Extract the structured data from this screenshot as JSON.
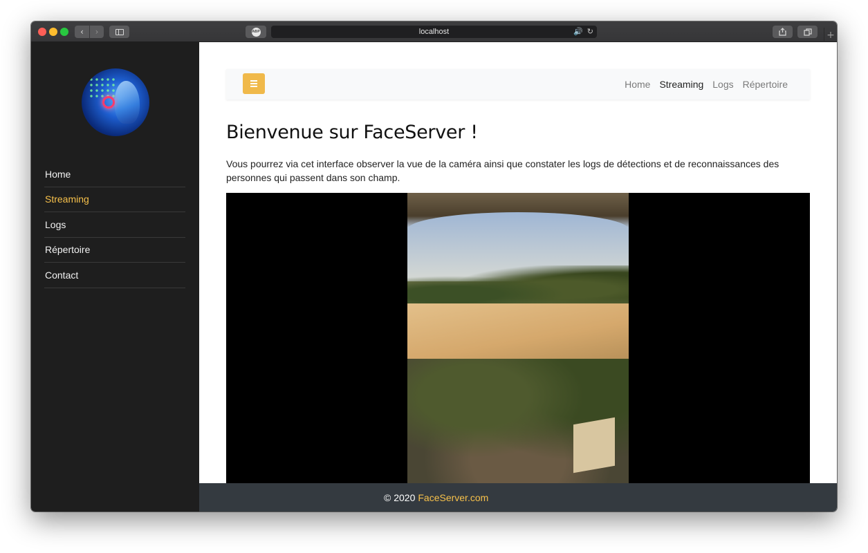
{
  "browser": {
    "url": "localhost",
    "abp_label": "ABP",
    "back_icon": "‹",
    "forward_icon": "›",
    "new_tab_icon": "+"
  },
  "sidebar": {
    "items": [
      {
        "label": "Home",
        "active": false
      },
      {
        "label": "Streaming",
        "active": true
      },
      {
        "label": "Logs",
        "active": false
      },
      {
        "label": "Répertoire",
        "active": false
      },
      {
        "label": "Contact",
        "active": false
      }
    ]
  },
  "topnav": {
    "items": [
      {
        "label": "Home",
        "active": false
      },
      {
        "label": "Streaming",
        "active": true
      },
      {
        "label": "Logs",
        "active": false
      },
      {
        "label": "Répertoire",
        "active": false
      }
    ]
  },
  "main": {
    "title": "Bienvenue sur FaceServer !",
    "intro": "Vous pourrez via cet interface observer la vue de la caméra ainsi que constater les logs de détections et de reconnaissances des personnes qui passent dans son champ."
  },
  "footer": {
    "copyright": "© 2020",
    "brand": "FaceServer.com"
  },
  "colors": {
    "accent": "#f7c14b",
    "sidebar_bg": "#1e1e1e",
    "footer_bg": "#343a40",
    "hamburger_bg": "#f0b94a"
  }
}
